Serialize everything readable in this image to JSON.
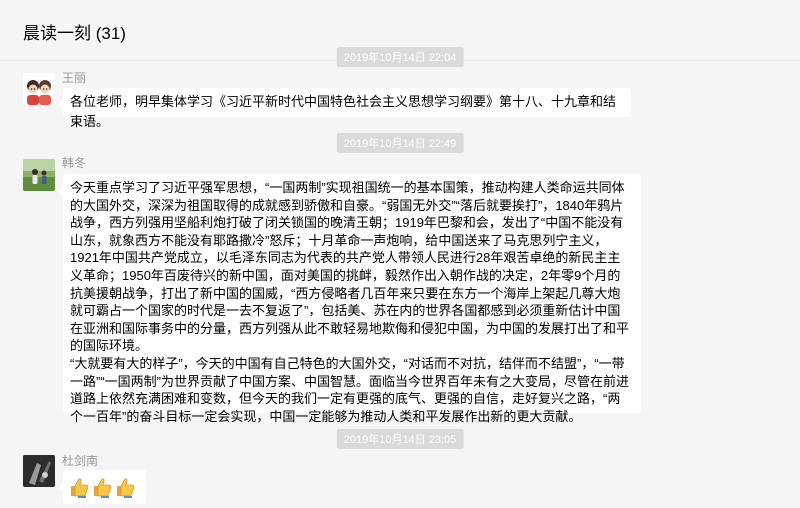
{
  "chat": {
    "title": "晨读一刻 (31)"
  },
  "messages": [
    {
      "timestamp": "2019年10月14日 22:04",
      "sender": "王丽",
      "text": "各位老师，明早集体学习《习近平新时代中国特色社会主义思想学习纲要》第十八、十九章和结束语。"
    },
    {
      "timestamp": "2019年10月14日 22:49",
      "sender": "韩冬",
      "paragraphs": [
        "今天重点学习了习近平强军思想，“一国两制”实现祖国统一的基本国策，推动构建人类命运共同体的大国外交，深深为祖国取得的成就感到骄傲和自豪。“弱国无外交”“落后就要挨打”，1840年鸦片战争，西方列强用坚船利炮打破了闭关锁国的晚清王朝；1919年巴黎和会，发出了“中国不能没有山东，就象西方不能没有耶路撒冷”怒斥；十月革命一声炮响，给中国送来了马克思列宁主义，1921年中国共产党成立，以毛泽东同志为代表的共产党人带领人民进行28年艰苦卓绝的新民主主义革命；1950年百废待兴的新中国，面对美国的挑衅，毅然作出入朝作战的决定，2年零9个月的抗美援朝战争，打出了新中国的国威，“西方侵略者几百年来只要在东方一个海岸上架起几尊大炮就可霸占一个国家的时代是一去不复返了”，包括美、苏在内的世界各国都感到必须重新估计中国在亚洲和国际事务中的分量，西方列强从此不敢轻易地欺侮和侵犯中国，为中国的发展打出了和平的国际环境。",
        "“大就要有大的样子”，今天的中国有自己特色的大国外交，“对话而不对抗，结伴而不结盟”，“一带一路”“一国两制”为世界贡献了中国方案、中国智慧。面临当今世界百年未有之大变局，尽管在前进道路上依然充满困难和变数，但今天的我们一定有更强的底气、更强的自信，走好复兴之路，“两个一百年”的奋斗目标一定会实现，中国一定能够为推动人类和平发展作出新的更大贡献。"
      ]
    },
    {
      "timestamp": "2019年10月14日 23:05",
      "sender": "杜剑南",
      "emoji": [
        "thumbs-up-icon",
        "thumbs-up-icon",
        "thumbs-up-icon"
      ]
    }
  ],
  "colors": {
    "background": "#f5f5f5",
    "bubble": "#ffffff",
    "timestamp_bg": "#dadada",
    "sender_text": "#999999"
  }
}
